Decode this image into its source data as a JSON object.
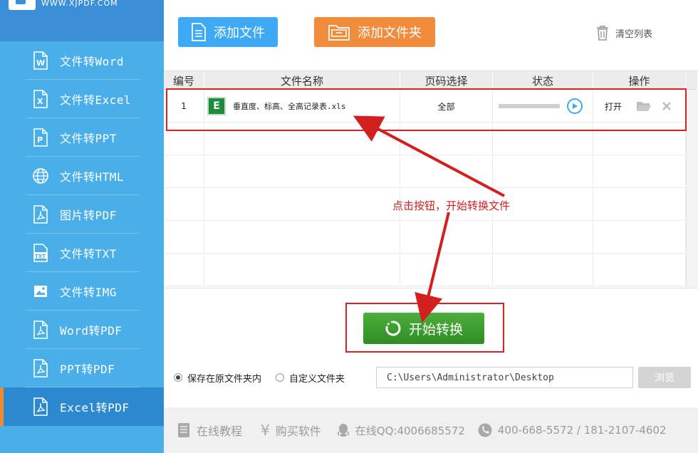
{
  "app": {
    "logo_url": "WWW.XJPDF.COM",
    "accent": "#4aaee8",
    "active_accent": "#f08a2b"
  },
  "sidebar": {
    "items": [
      {
        "label": "文件转Word",
        "icon": "word-doc-icon"
      },
      {
        "label": "文件转Excel",
        "icon": "excel-doc-icon"
      },
      {
        "label": "文件转PPT",
        "icon": "ppt-doc-icon"
      },
      {
        "label": "文件转HTML",
        "icon": "globe-icon"
      },
      {
        "label": "图片转PDF",
        "icon": "pdf-doc-icon"
      },
      {
        "label": "文件转TXT",
        "icon": "txt-doc-icon"
      },
      {
        "label": "文件转IMG",
        "icon": "image-icon"
      },
      {
        "label": "Word转PDF",
        "icon": "pdf-doc-icon"
      },
      {
        "label": "PPT转PDF",
        "icon": "pdf-doc-icon"
      },
      {
        "label": "Excel转PDF",
        "icon": "pdf-doc-icon",
        "active": true
      }
    ]
  },
  "toolbar": {
    "add_file": "添加文件",
    "add_folder": "添加文件夹",
    "clear_list": "清空列表"
  },
  "table": {
    "headers": [
      "编号",
      "文件名称",
      "页码选择",
      "状态",
      "操作"
    ],
    "rows": [
      {
        "no": "1",
        "file_badge": "E",
        "filename": "垂直度、标高、全高记录表.xls",
        "pages": "全部",
        "progress": 0,
        "action_open": "打开"
      }
    ]
  },
  "annotation": {
    "text": "点击按钮，开始转换文件",
    "color": "#d31f1f"
  },
  "convert": {
    "start_label": "开始转换"
  },
  "save": {
    "option_original": "保存在原文件夹内",
    "option_custom": "自定义文件夹",
    "selected": "original",
    "path": "C:\\Users\\Administrator\\Desktop",
    "browse": "浏览"
  },
  "footer": {
    "tutorial": "在线教程",
    "buy": "购买软件",
    "qq": "在线QQ:4006685572",
    "phone": "400-668-5572 / 181-2107-4602"
  }
}
